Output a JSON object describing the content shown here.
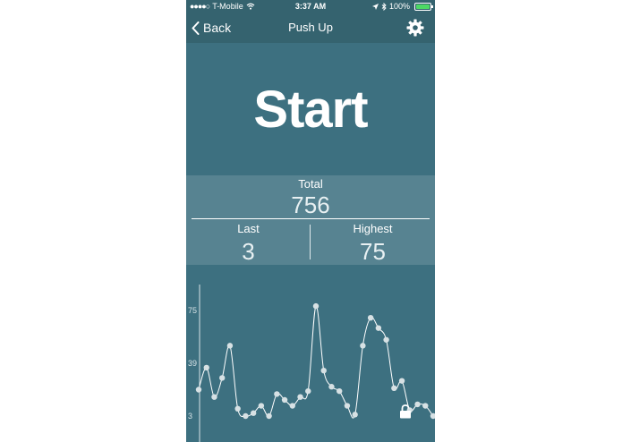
{
  "status_bar": {
    "signal_dots": "●●●●○",
    "carrier": "T-Mobile",
    "wifi_icon": "wifi-icon",
    "time": "3:37 AM",
    "battery_percent": "100%",
    "battery_level": 1.0
  },
  "nav": {
    "back_label": "Back",
    "title": "Push Up"
  },
  "main": {
    "start_label": "Start"
  },
  "stats": {
    "total_label": "Total",
    "total_value": "756",
    "last_label": "Last",
    "last_value": "3",
    "highest_label": "Highest",
    "highest_value": "75"
  },
  "colors": {
    "background": "#3d7080",
    "bar": "#35636f",
    "stats_panel": "#578391",
    "battery_green": "#4cd964"
  },
  "chart_data": {
    "type": "line",
    "y_ticks": [
      "75",
      "39",
      "3"
    ],
    "ylim": [
      0,
      86
    ],
    "values": [
      21,
      36,
      16,
      29,
      51,
      8,
      3,
      5,
      10,
      3,
      18,
      14,
      10,
      16,
      20,
      78,
      34,
      23,
      20,
      10,
      4,
      51,
      70,
      63,
      55,
      22,
      27,
      7,
      11,
      10,
      3
    ],
    "grid": false
  }
}
